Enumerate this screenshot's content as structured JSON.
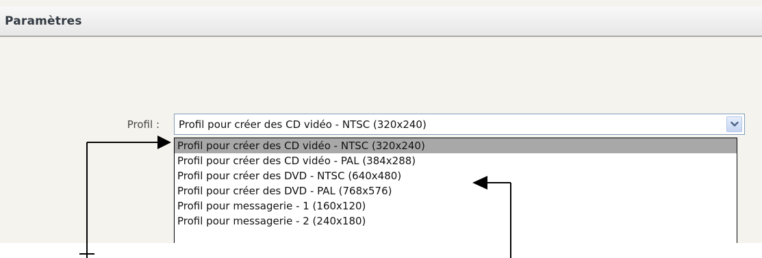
{
  "panel": {
    "title": "Paramètres"
  },
  "profile": {
    "label": "Profil :",
    "selected_value": "Profil pour créer des CD vidéo - NTSC (320x240)",
    "options": [
      "Profil pour créer des CD vidéo - NTSC (320x240)",
      "Profil pour créer des CD vidéo - PAL (384x288)",
      "Profil pour créer des DVD - NTSC (640x480)",
      "Profil pour créer des DVD - PAL (768x576)",
      "Profil pour messagerie - 1 (160x120)",
      "Profil pour messagerie - 2 (240x180)"
    ],
    "highlighted_index": 0,
    "dropdown_icon": "chevron-down-icon"
  },
  "colors": {
    "panel_bg": "#f4f3ee",
    "header_border": "#a9a9a9",
    "highlight": "#a8a8a8",
    "combo_border": "#7f9db9",
    "callout": "#000000"
  }
}
